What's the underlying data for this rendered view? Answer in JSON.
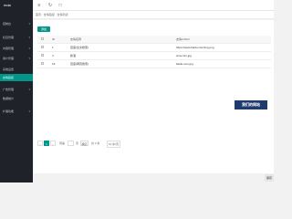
{
  "app": {
    "logo": "mda"
  },
  "sidebar": {
    "items": [
      {
        "label": "控制台",
        "active": false
      },
      {
        "label": "栏目管理",
        "active": false
      },
      {
        "label": "内容管理",
        "active": false
      },
      {
        "label": "用户管理",
        "active": false
      },
      {
        "label": "系统设置",
        "active": false
      },
      {
        "label": "友情链接",
        "active": true
      },
      {
        "label": "广告管理",
        "active": false
      },
      {
        "label": "数据统计",
        "active": false
      },
      {
        "label": "扩展功能",
        "active": false
      }
    ]
  },
  "topbar": {
    "icons": [
      "menu-icon",
      "refresh-icon",
      "screen-icon"
    ]
  },
  "breadcrumb": {
    "items": [
      "首页",
      "友情链接",
      "友情列表"
    ]
  },
  "toolbar": {
    "add_label": "添加"
  },
  "table": {
    "headers": [
      "ID",
      "友情名称",
      "友情LOGO"
    ],
    "rows": [
      {
        "id": "1",
        "name": "百度(全文搜索)",
        "logo": "https://www.baidu.com/img.png"
      },
      {
        "id": "4",
        "name": "新浪",
        "logo": "sina.com.jpg"
      },
      {
        "id": "16",
        "name": "百度(网页搜索)",
        "logo": "baidu.com.jpg"
      }
    ]
  },
  "overlay": {
    "text": "我们的网站"
  },
  "pager": {
    "current": "1",
    "goto_label": "到第",
    "page_label": "页",
    "confirm_label": "确定",
    "total": "共 3 条",
    "per_page": "10 条/页"
  },
  "footer": {
    "button": "保存"
  }
}
